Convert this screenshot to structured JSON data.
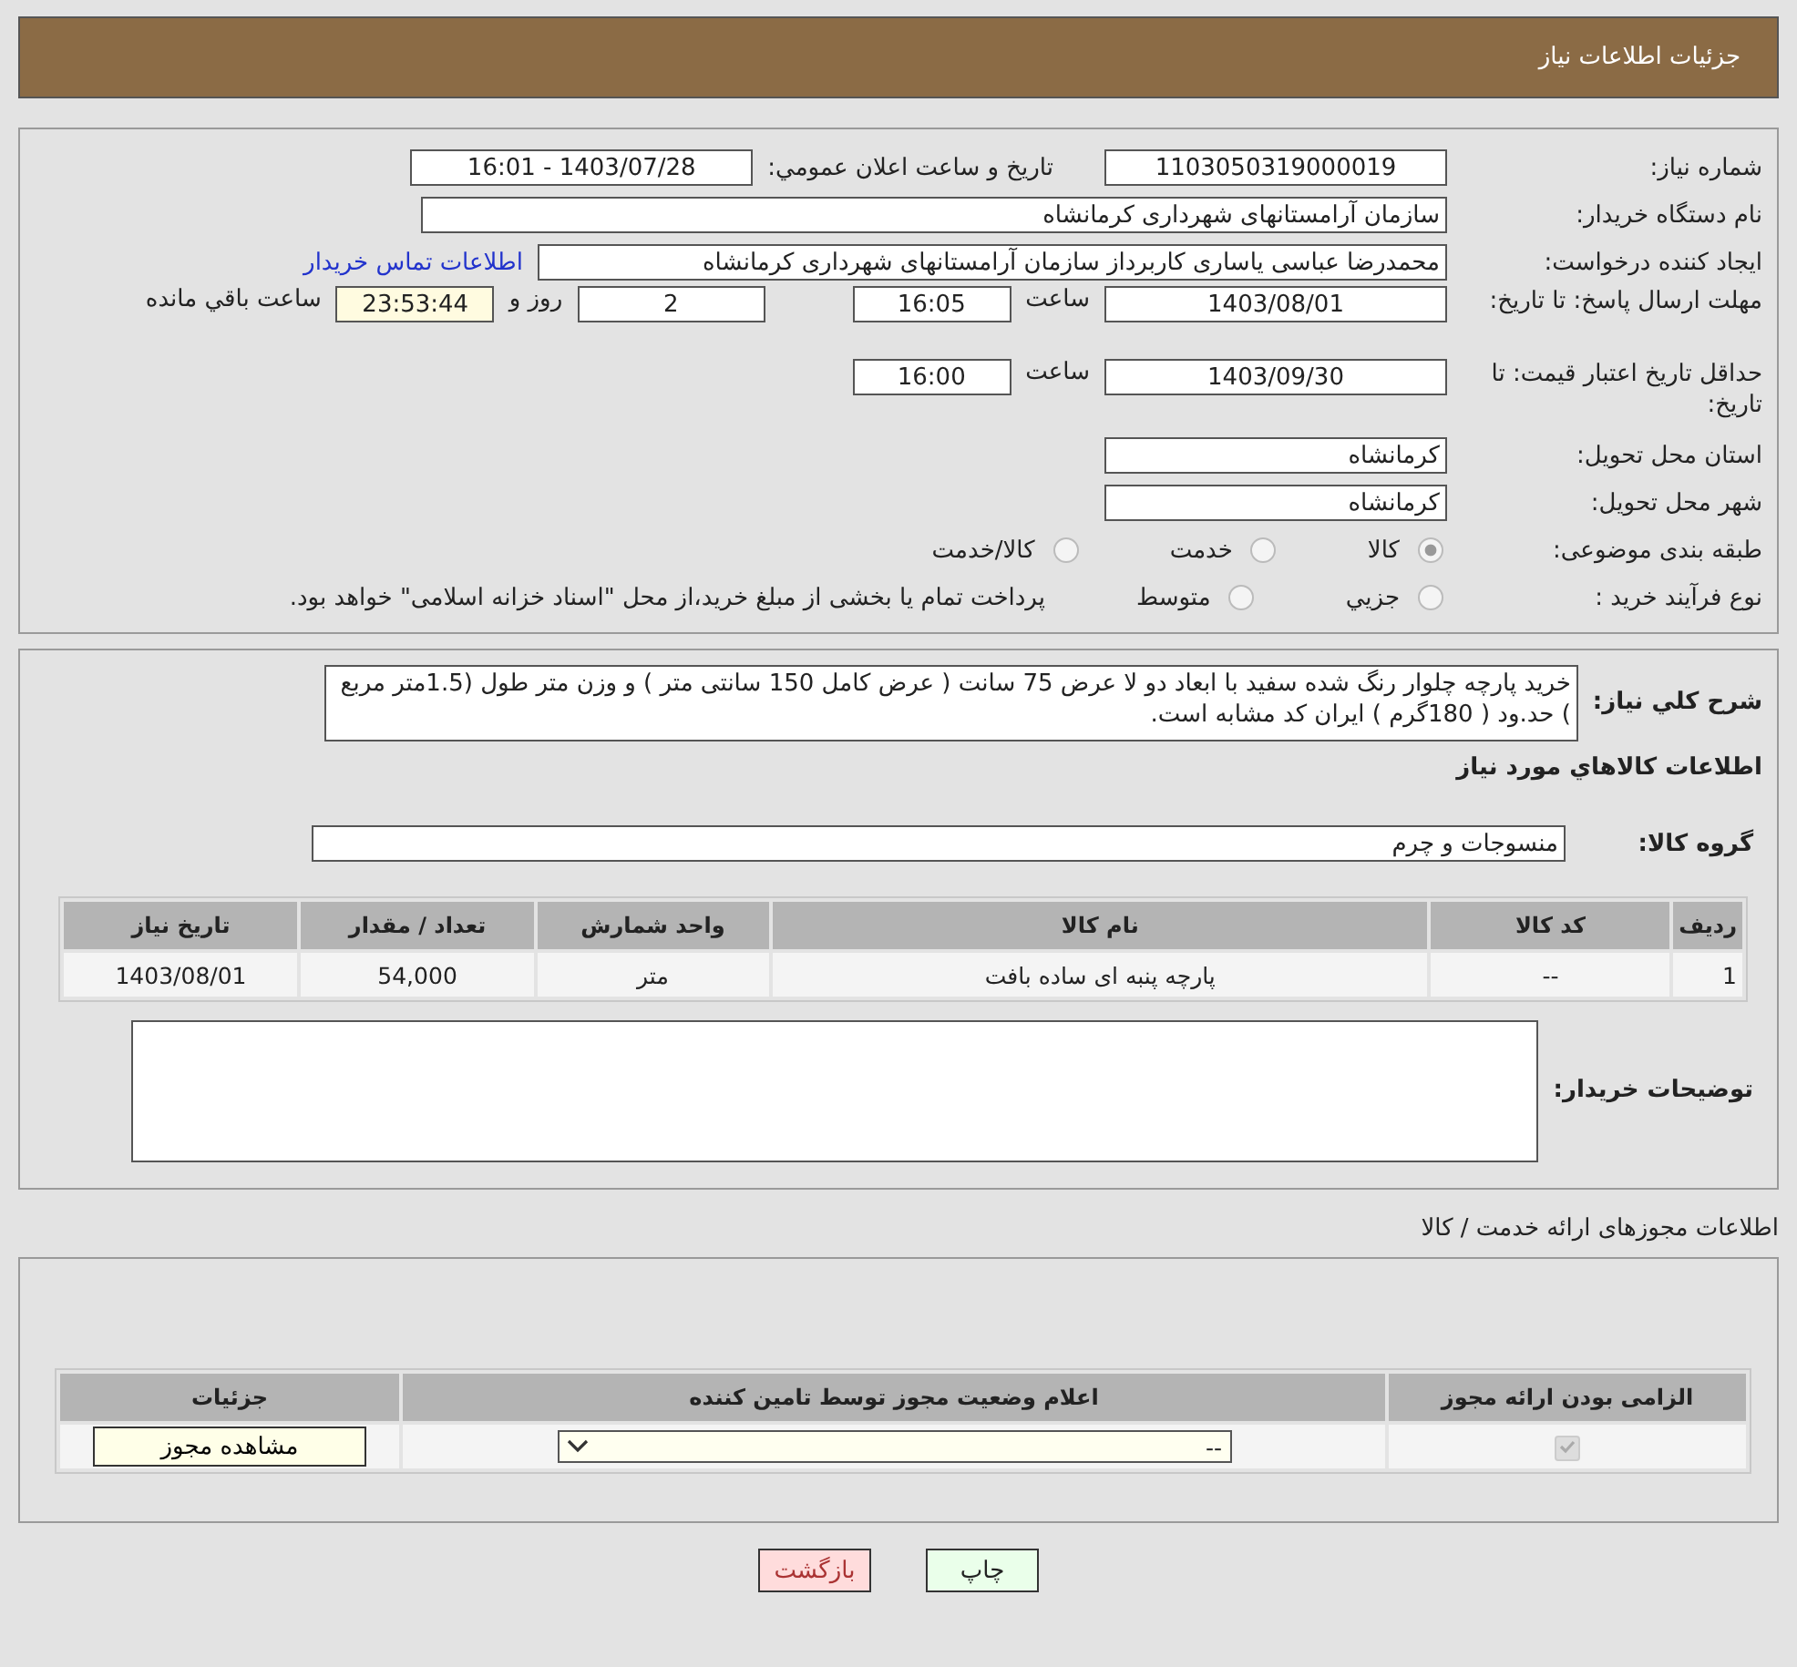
{
  "header": {
    "title": "جزئیات اطلاعات نیاز"
  },
  "need": {
    "number_label": "شماره نیاز:",
    "number": "1103050319000019",
    "announce_label": "تاریخ و ساعت اعلان عمومي:",
    "announce": "1403/07/28 - 16:01",
    "buyer_label": "نام دستگاه خريدار:",
    "buyer": "سازمان آرامستانهای شهرداری کرمانشاه",
    "creator_label": "ایجاد کننده درخواست:",
    "creator": "محمدرضا عباسی یاساری کاربرداز سازمان آرامستانهای شهرداری کرمانشاه",
    "contact_link": "اطلاعات تماس خریدار",
    "deadline_label": "مهلت ارسال پاسخ: تا تاریخ:",
    "deadline_date": "1403/08/01",
    "time_label": "ساعت",
    "deadline_time": "16:05",
    "days": "2",
    "days_label": "روز و",
    "remaining": "23:53:44",
    "remaining_label": "ساعت باقي مانده",
    "validity_label": "حداقل تاریخ اعتبار قیمت: تا تاریخ:",
    "validity_date": "1403/09/30",
    "validity_time_label": "ساعت",
    "validity_time": "16:00",
    "province_label": "استان محل تحویل:",
    "province": "کرمانشاه",
    "city_label": "شهر محل تحویل:",
    "city": "کرمانشاه",
    "category_label": "طبقه بندی موضوعی:",
    "categories": [
      {
        "label": "کالا",
        "selected": true
      },
      {
        "label": "خدمت",
        "selected": false
      },
      {
        "label": "کالا/خدمت",
        "selected": false
      }
    ],
    "process_label": "نوع فرآیند خرید :",
    "processes": [
      {
        "label": "جزيي",
        "selected": false
      },
      {
        "label": "متوسط",
        "selected": false
      }
    ],
    "payment_note": "پرداخت تمام یا بخشی از مبلغ خرید،از محل \"اسناد خزانه اسلامی\" خواهد بود."
  },
  "goods": {
    "description_label": "شرح کلي نياز:",
    "description": "خرید پارچه چلوار رنگ شده سفید با ابعاد دو لا عرض 75 سانت ( عرض کامل 150 سانتی متر ) و وزن متر طول (1.5متر مربع ) حد.ود ( 180گرم ) ایران کد مشابه است.",
    "section_title": "اطلاعات کالاهاي مورد نياز",
    "group_label": "گروه کالا:",
    "group": "منسوجات و چرم",
    "columns": [
      "ردیف",
      "کد کالا",
      "نام کالا",
      "واحد شمارش",
      "تعداد / مقدار",
      "تاریخ نیاز"
    ],
    "rows": [
      [
        "1",
        "--",
        "پارچه پنبه ای ساده بافت",
        "متر",
        "54,000",
        "1403/08/01"
      ]
    ],
    "notes_label": "توضیحات خریدار:"
  },
  "permits": {
    "title": "اطلاعات مجوزهای ارائه خدمت / کالا",
    "columns": [
      "الزامی بودن ارائه مجوز",
      "اعلام وضعیت مجوز توسط تامین کننده",
      "جزئیات"
    ],
    "rows": [
      {
        "required": true,
        "status": "--",
        "details_button": "مشاهده مجوز"
      }
    ]
  },
  "buttons": [
    {
      "kind": "print",
      "label": "چاپ"
    },
    {
      "kind": "back",
      "label": "بازگشت"
    }
  ]
}
